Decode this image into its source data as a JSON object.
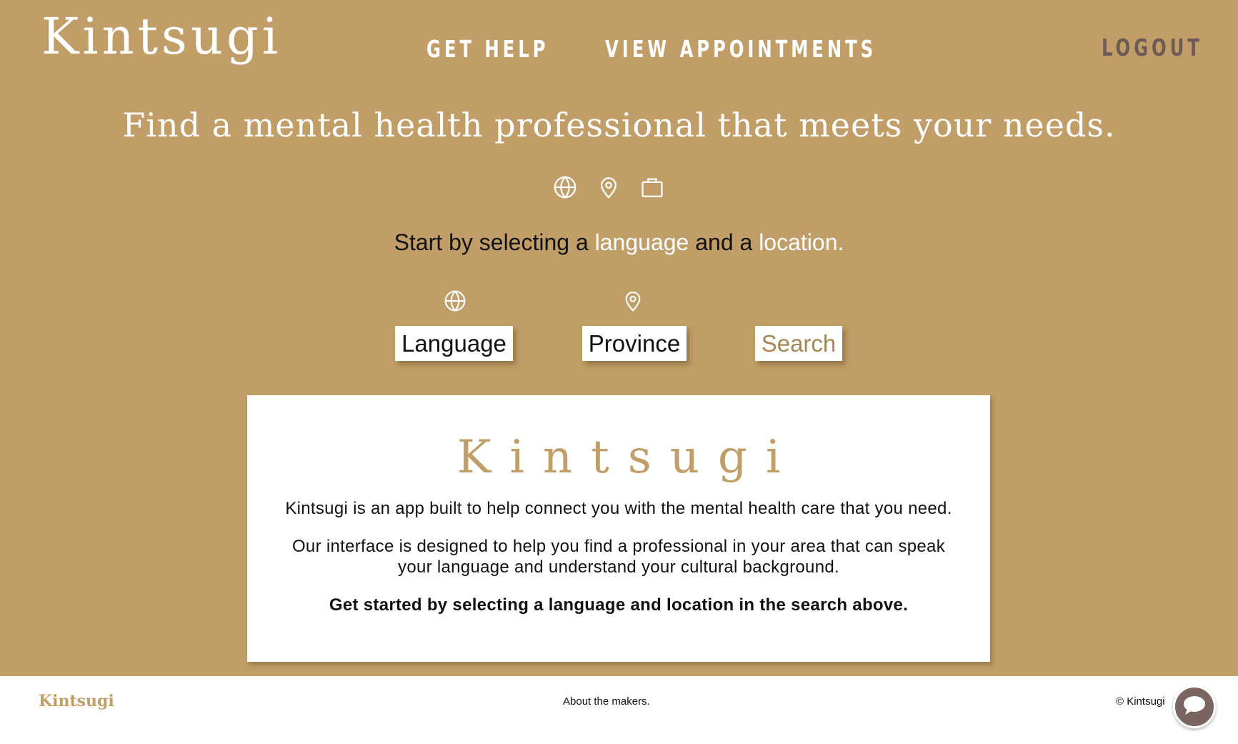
{
  "header": {
    "brand": "Kintsugi",
    "nav": {
      "get_help": "GET HELP",
      "view_appointments": "VIEW APPOINTMENTS",
      "logout": "LOGOUT"
    }
  },
  "hero": {
    "tagline": "Find a mental health professional that meets your needs.",
    "icons": [
      "globe-icon",
      "map-pin-icon",
      "briefcase-icon"
    ],
    "instruction": {
      "prefix": "Start by selecting a ",
      "highlight_1": "language",
      "middle": " and a ",
      "highlight_2": "location."
    }
  },
  "search": {
    "language_label": "Language",
    "language_icon": "globe-icon",
    "province_label": "Province",
    "province_icon": "map-pin-icon",
    "search_label": "Search"
  },
  "info_card": {
    "title": "Kintsugi",
    "paragraph_1": "Kintsugi is an app built to help connect you with the mental health care that you need.",
    "paragraph_2": "Our interface is designed to help you find a professional in your area that can speak your language and understand your cultural background.",
    "paragraph_3": "Get started by selecting a language and location in the search above."
  },
  "footer": {
    "brand": "Kintsugi",
    "about_link": "About the makers.",
    "copyright": "© Kintsugi"
  },
  "chat": {
    "icon": "chat-bubble-icon"
  },
  "colors": {
    "background": "#c19e67",
    "accent": "#c19e67",
    "logout_text": "#6e5b55",
    "chat_button": "#7a6560",
    "search_text": "#a68656"
  }
}
